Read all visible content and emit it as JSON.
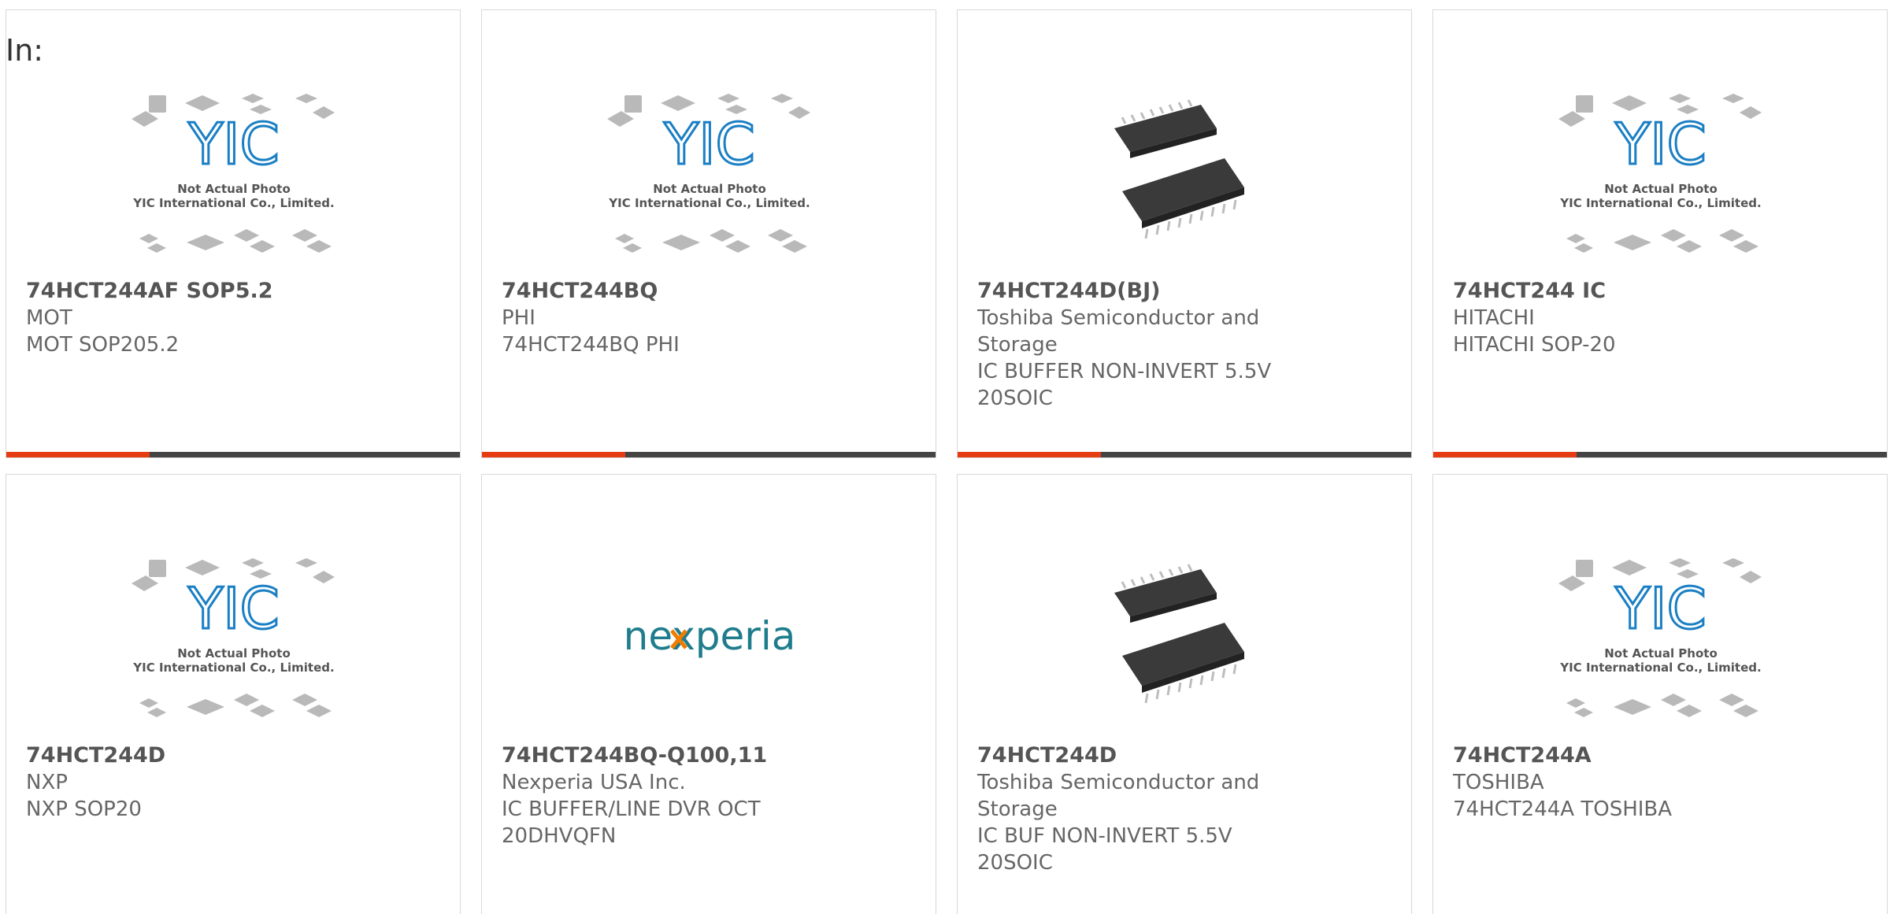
{
  "header": {
    "label": "In:"
  },
  "colors": {
    "accent": "#e63c14",
    "bar": "#444444",
    "border": "#d8d8d8",
    "text": "#666666",
    "logo_blue": "#1a7fc4",
    "nexperia_teal": "#1e7c8c",
    "nexperia_orange": "#f07c00"
  },
  "products": [
    {
      "part": "74HCT244AF SOP5.2",
      "manufacturer": "MOT",
      "description": "MOT SOP205.2",
      "image": "placeholder-yic",
      "note1": "Not Actual Photo",
      "note2": "YIC International Co., Limited."
    },
    {
      "part": "74HCT244BQ",
      "manufacturer": "PHI",
      "description": "74HCT244BQ PHI",
      "image": "placeholder-yic",
      "note1": "Not Actual Photo",
      "note2": "YIC International Co., Limited."
    },
    {
      "part": "74HCT244D(BJ)",
      "manufacturer": "Toshiba Semiconductor and Storage",
      "description": "IC BUFFER NON-INVERT 5.5V 20SOIC",
      "image": "soic-chip-photo"
    },
    {
      "part": "74HCT244 IC",
      "manufacturer": "HITACHI",
      "description": "HITACHI SOP-20",
      "image": "placeholder-yic",
      "note1": "Not Actual Photo",
      "note2": "YIC International Co., Limited."
    },
    {
      "part": "74HCT244D",
      "manufacturer": "NXP",
      "description": "NXP SOP20",
      "image": "placeholder-yic",
      "note1": "Not Actual Photo",
      "note2": "YIC International Co., Limited."
    },
    {
      "part": "74HCT244BQ-Q100,11",
      "manufacturer": "Nexperia USA Inc.",
      "description": "IC BUFFER/LINE DVR OCT 20DHVQFN",
      "image": "nexperia-logo",
      "logo_text": "nexperia"
    },
    {
      "part": "74HCT244D",
      "manufacturer": "Toshiba Semiconductor and Storage",
      "description": "IC BUF NON-INVERT 5.5V 20SOIC",
      "image": "soic-chip-photo"
    },
    {
      "part": "74HCT244A",
      "manufacturer": "TOSHIBA",
      "description": "74HCT244A TOSHIBA",
      "image": "placeholder-yic",
      "note1": "Not Actual Photo",
      "note2": "YIC International Co., Limited."
    }
  ]
}
